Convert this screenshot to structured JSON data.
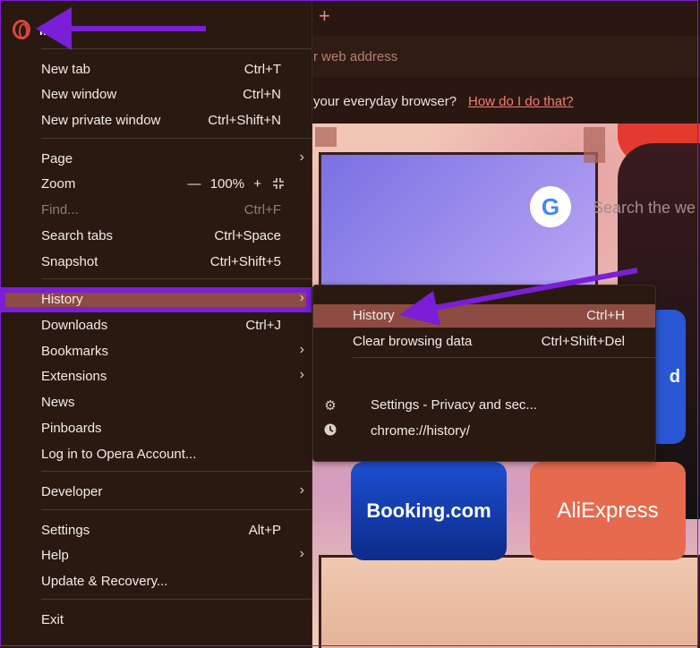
{
  "browser": {
    "new_tab_symbol": "+",
    "address_placeholder": "r web address",
    "info_text": "your everyday browser?",
    "info_link": "How do I do that?",
    "search_placeholder": "Search the we",
    "tiles": {
      "booking": "Booking.com",
      "aliexpress": "AliExpress",
      "partial": "d"
    },
    "google_letter": "G"
  },
  "menu": {
    "title": "M",
    "sections": [
      [
        {
          "label": "New tab",
          "shortcut": "Ctrl+T"
        },
        {
          "label": "New window",
          "shortcut": "Ctrl+N"
        },
        {
          "label": "New private window",
          "shortcut": "Ctrl+Shift+N"
        }
      ],
      [
        {
          "label": "Page"
        },
        {
          "label": "Zoom"
        },
        {
          "label": "Find...",
          "shortcut": "Ctrl+F"
        },
        {
          "label": "Search tabs",
          "shortcut": "Ctrl+Space"
        },
        {
          "label": "Snapshot",
          "shortcut": "Ctrl+Shift+5"
        }
      ],
      [
        {
          "label": "History"
        },
        {
          "label": "Downloads",
          "shortcut": "Ctrl+J"
        },
        {
          "label": "Bookmarks"
        },
        {
          "label": "Extensions"
        },
        {
          "label": "News"
        },
        {
          "label": "Pinboards"
        },
        {
          "label": "Log in to Opera Account..."
        }
      ],
      [
        {
          "label": "Developer"
        }
      ],
      [
        {
          "label": "Settings",
          "shortcut": "Alt+P"
        },
        {
          "label": "Help"
        },
        {
          "label": "Update & Recovery..."
        }
      ],
      [
        {
          "label": "Exit"
        }
      ]
    ],
    "zoom": {
      "minus": "—",
      "value": "100%",
      "plus": "+"
    }
  },
  "history_submenu": {
    "items": [
      {
        "label": "History",
        "shortcut": "Ctrl+H"
      },
      {
        "label": "Clear browsing data",
        "shortcut": "Ctrl+Shift+Del"
      }
    ],
    "recent": [
      {
        "icon": "gear-icon",
        "label": "Settings - Privacy and sec..."
      },
      {
        "icon": "clock-icon",
        "label": "chrome://history/"
      }
    ]
  },
  "colors": {
    "menu_bg": "#2a1911",
    "highlight": "#8e4b42",
    "annotation_purple": "#7a1fd6",
    "opera_red": "#d9483b"
  }
}
